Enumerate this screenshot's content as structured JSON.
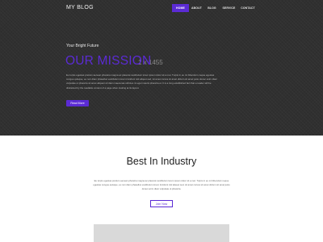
{
  "header": {
    "brand": "MY BLOG",
    "nav": [
      {
        "label": "HOME",
        "active": true
      },
      {
        "label": "ABOUT",
        "active": false
      },
      {
        "label": "BLOG",
        "active": false
      },
      {
        "label": "SERVICE",
        "active": false
      },
      {
        "label": "CONTACT",
        "active": false
      }
    ]
  },
  "hero": {
    "tagline": "Your Bright Future",
    "title": "OUR MISSION",
    "placeholder_mark": "1 x 1455",
    "body": "Eu turpis egestas pretium aenean pharetra magna ac placerat vestibulum lorem ipsum dolor sit a met. Turpis in eu mi bibendum neque egestas congue quisque, eu non diam phasellus vestibulum lorem tincidunt nisl aliquet sed, sit amet cursus sit amet dictum sit amet justo donec enim diam vulputate ut pharetra sit amet aliquam id diam maecenas ultricies mi eget mauris pharetra et. It is a long established fact that a reader will be distracted by the readable content of a page when looking at its layout.",
    "button": "Read More"
  },
  "industry": {
    "title": "Best In Industry",
    "body": "Eu turpis egestas pretium aenean pharetra magna ac placerat vestibulum lorem ipsum dolor sit a met. Turpis in eu mi bibendum neque egestas congue quisque, eu non diam phasellus vestibulum lorem tincidunt nisl aliquet sed, sit amet cursus sit amet dictum sit amet justo donec enim diam vulputate ut pharetra.",
    "button": "Join Now"
  },
  "colors": {
    "accent": "#5b2bd4",
    "hero_background": "#303030",
    "image_placeholder": "#d9d9d9"
  }
}
